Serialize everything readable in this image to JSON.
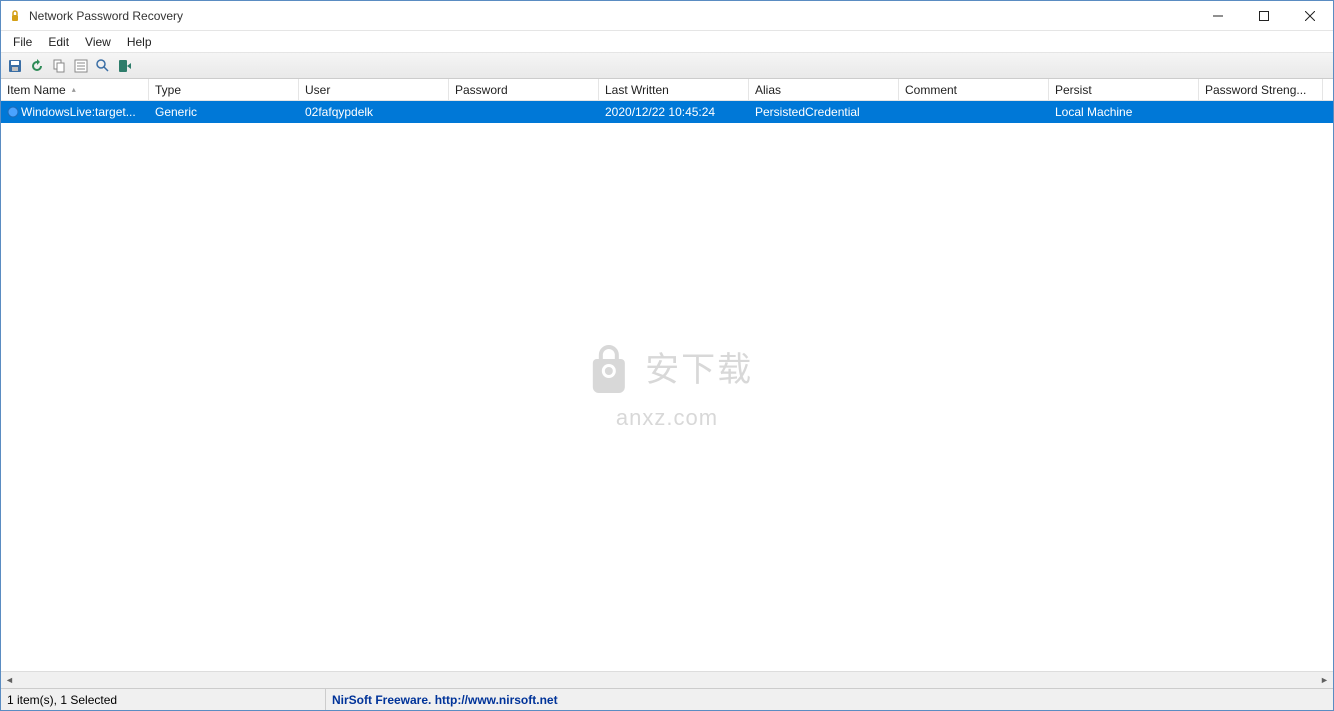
{
  "window": {
    "title": "Network Password Recovery"
  },
  "menu": {
    "file": "File",
    "edit": "Edit",
    "view": "View",
    "help": "Help"
  },
  "columns": {
    "item_name": "Item Name",
    "type": "Type",
    "user": "User",
    "password": "Password",
    "last_written": "Last Written",
    "alias": "Alias",
    "comment": "Comment",
    "persist": "Persist",
    "password_strength": "Password Streng..."
  },
  "rows": [
    {
      "item_name": "WindowsLive:target...",
      "type": "Generic",
      "user": "02fafqypdelk",
      "password": "",
      "last_written": "2020/12/22 10:45:24",
      "alias": "PersistedCredential",
      "comment": "",
      "persist": "Local Machine",
      "password_strength": ""
    }
  ],
  "statusbar": {
    "items": "1 item(s), 1 Selected",
    "credit": "NirSoft Freeware.  http://www.nirsoft.net"
  },
  "watermark": {
    "line1": "安下载",
    "line2": "anxz.com"
  }
}
